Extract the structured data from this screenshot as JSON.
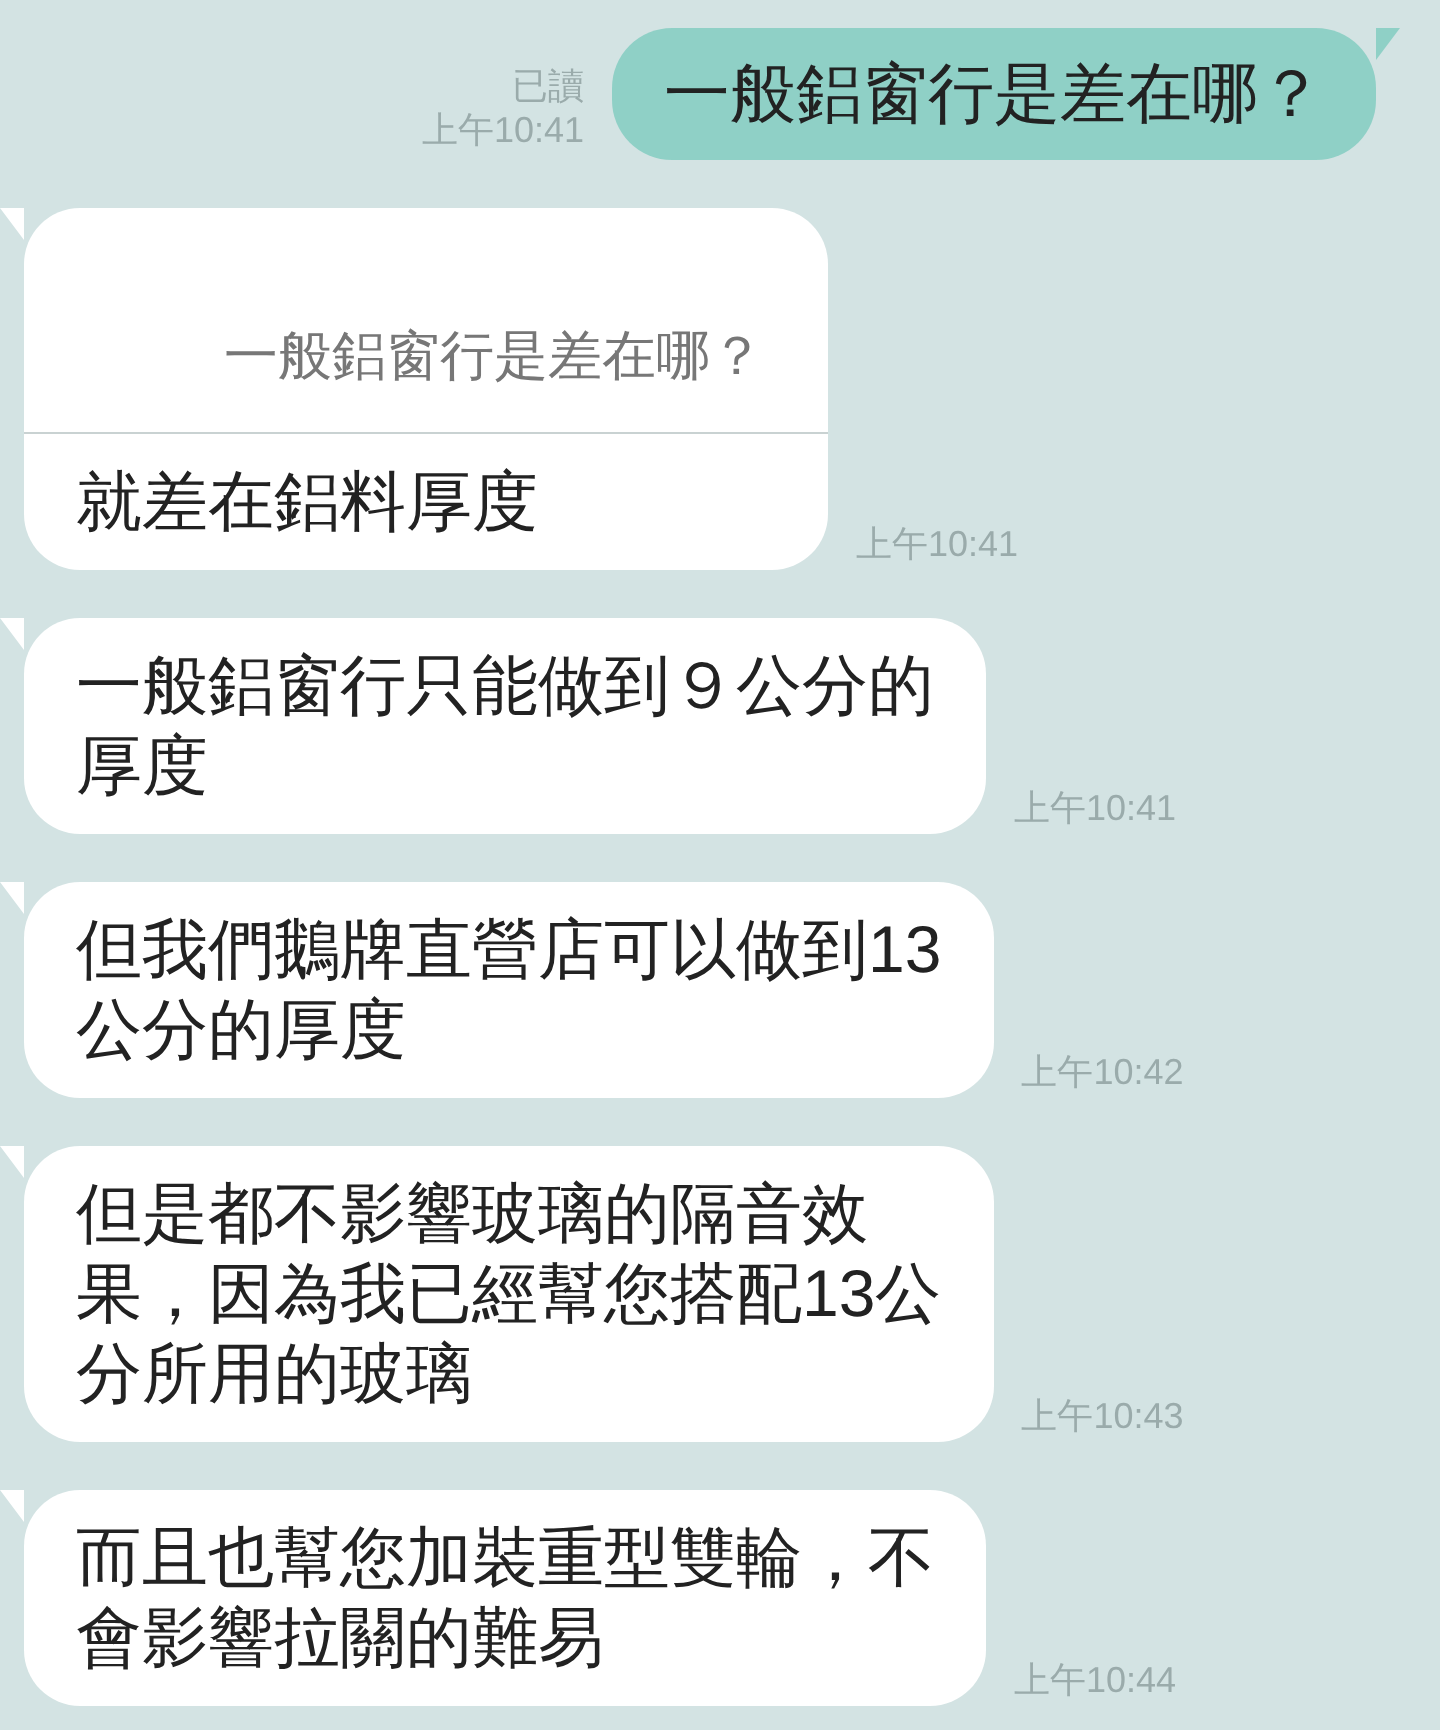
{
  "messages": [
    {
      "kind": "sent",
      "lines": [
        "一般鋁窗行是差在哪？"
      ],
      "read_label": "已讀",
      "time": "上午10:41"
    },
    {
      "kind": "received",
      "quote": "一般鋁窗行是差在哪？",
      "lines": [
        "就差在鋁料厚度"
      ],
      "time": "上午10:41"
    },
    {
      "kind": "received",
      "lines": [
        "一般鋁窗行只能做到９公分的",
        "厚度"
      ],
      "time": "上午10:41"
    },
    {
      "kind": "received",
      "lines": [
        "但我們鵝牌直營店可以做到13",
        "公分的厚度"
      ],
      "time": "上午10:42"
    },
    {
      "kind": "received",
      "lines": [
        "但是都不影響玻璃的隔音效",
        "果，因為我已經幫您搭配13公",
        "分所用的玻璃"
      ],
      "time": "上午10:43"
    },
    {
      "kind": "received",
      "lines": [
        "而且也幫您加裝重型雙輪，不",
        "會影響拉關的難易"
      ],
      "time": "上午10:44"
    }
  ]
}
